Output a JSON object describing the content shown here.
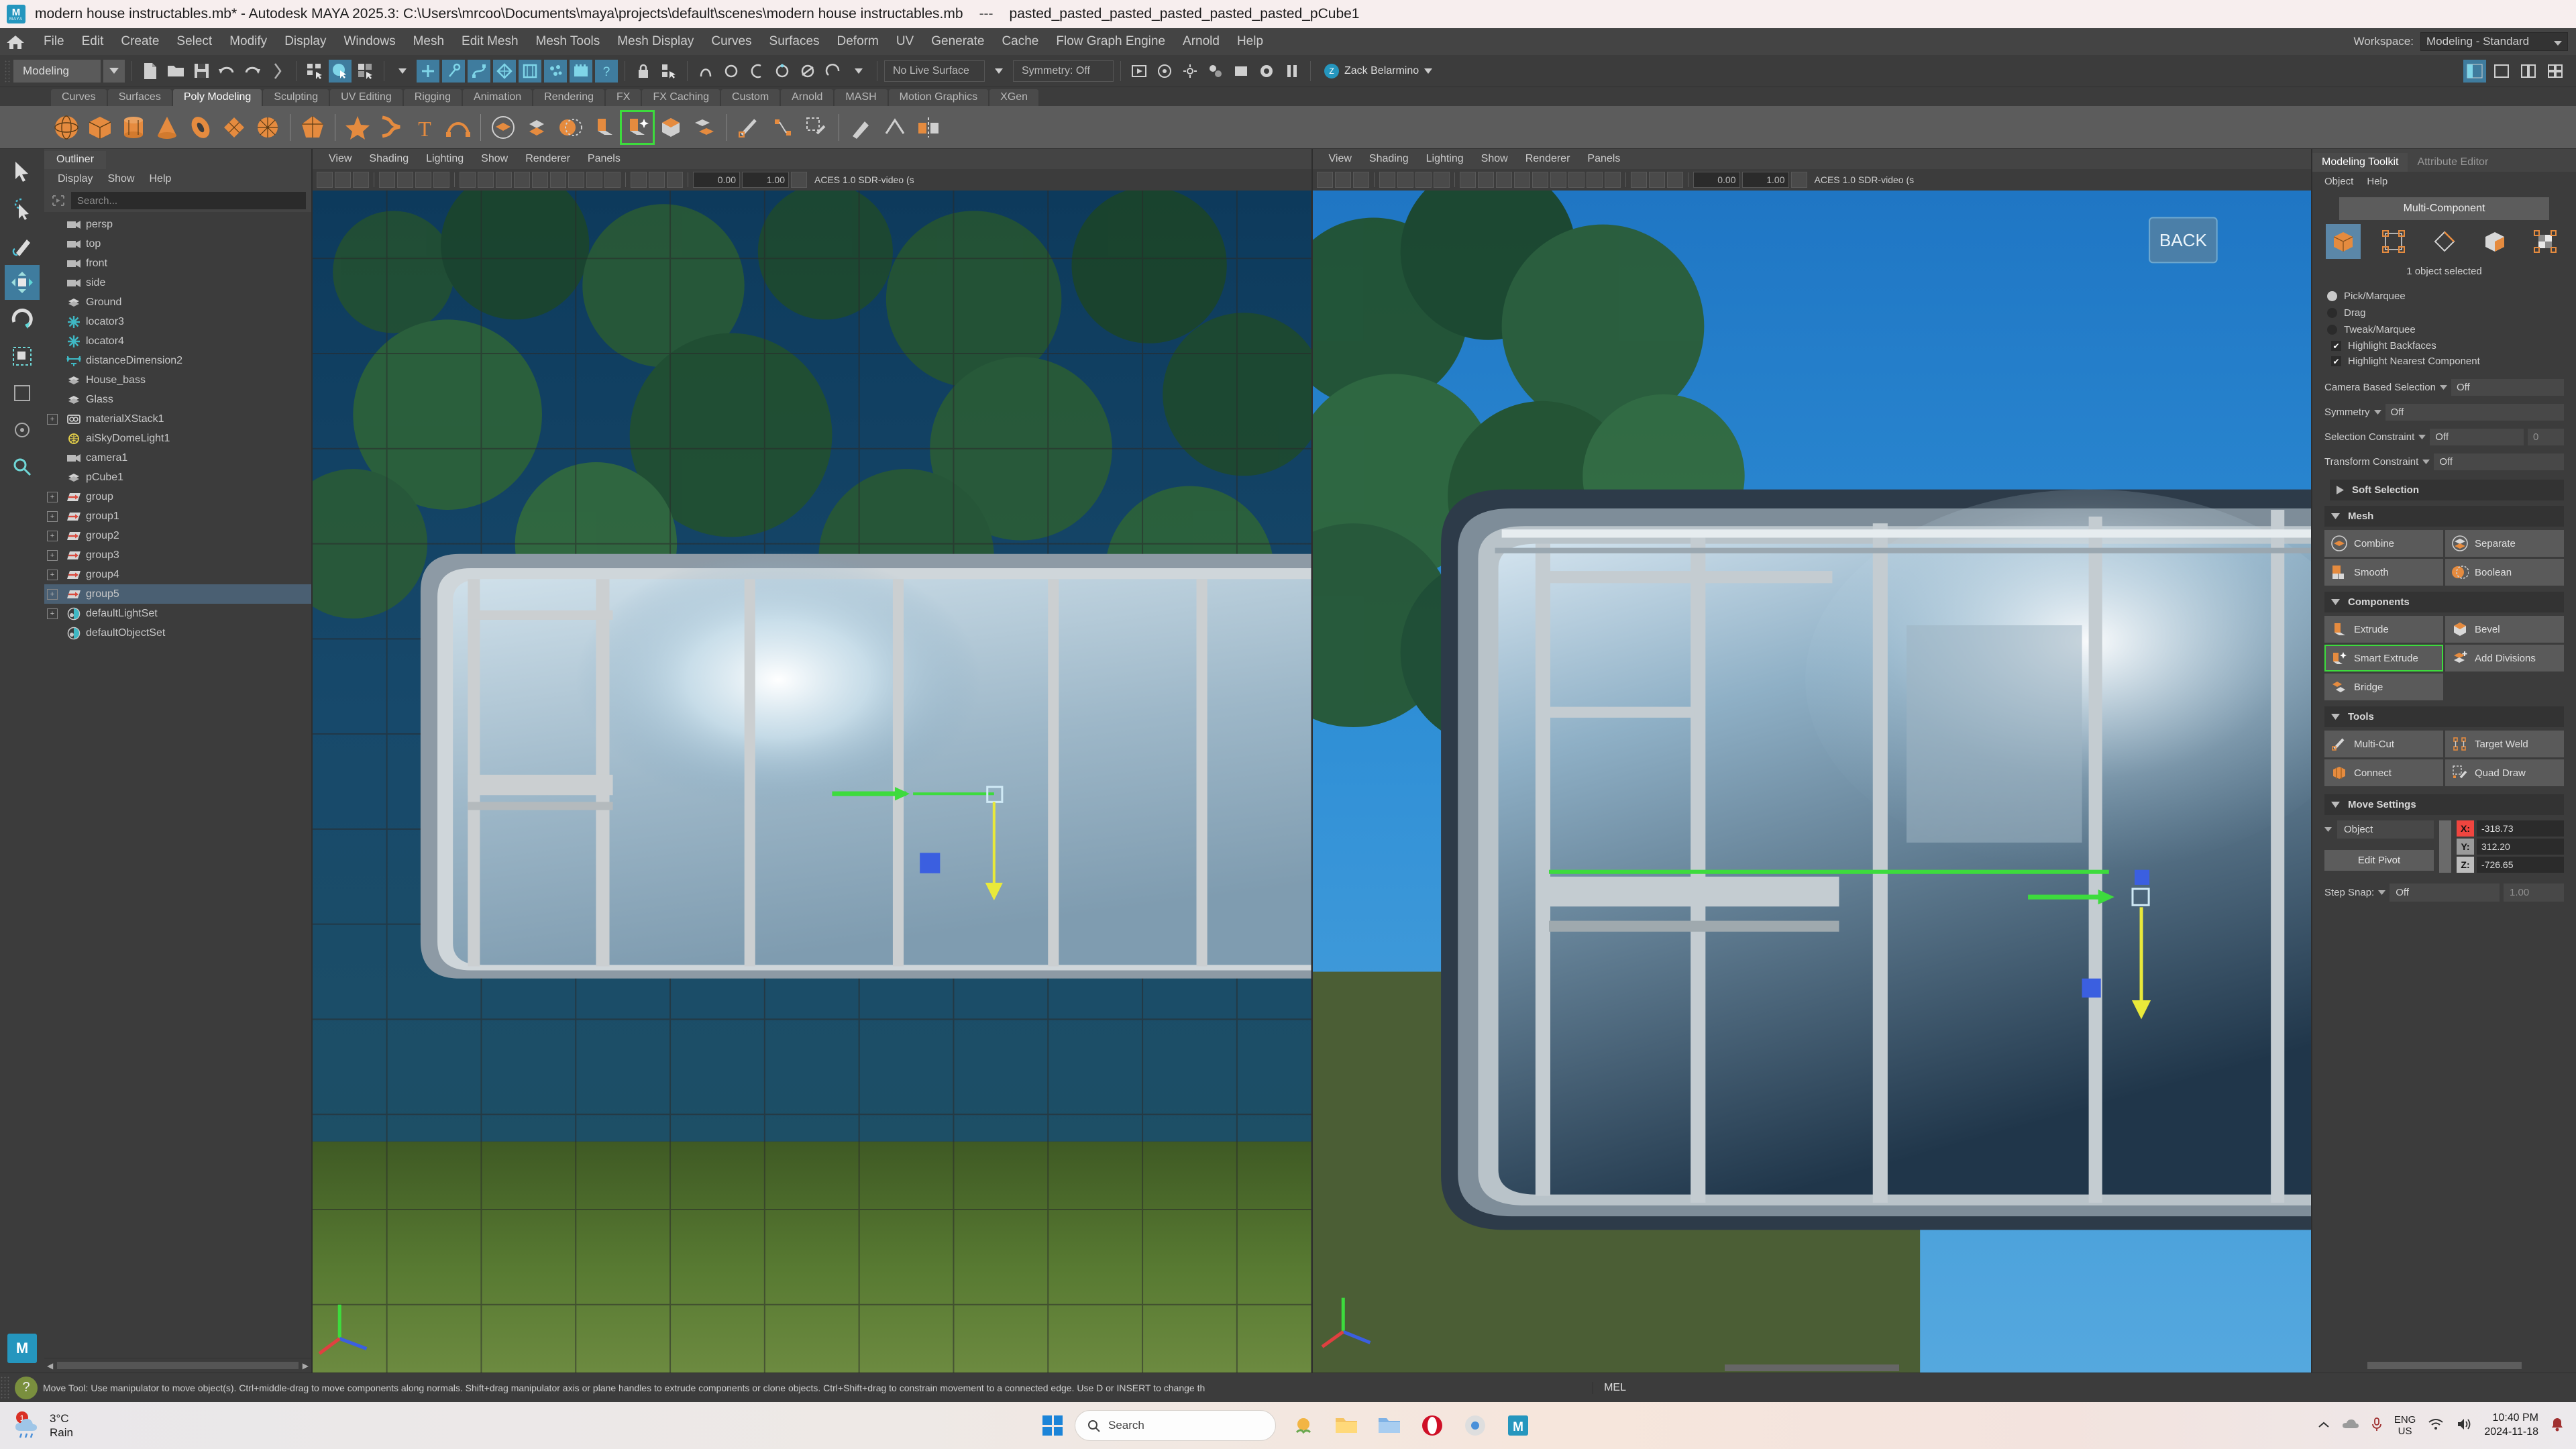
{
  "window": {
    "app_icon": "maya-logo",
    "title": "modern house instructables.mb* - Autodesk MAYA 2025.3: C:\\Users\\mrcoo\\Documents\\maya\\projects\\default\\scenes\\modern house instructables.mb",
    "separator": "---",
    "selected_object": "pasted_pasted_pasted_pasted_pasted_pasted_pCube1"
  },
  "menubar": {
    "home_icon": "home-icon",
    "items": [
      "File",
      "Edit",
      "Create",
      "Select",
      "Modify",
      "Display",
      "Windows",
      "Mesh",
      "Edit Mesh",
      "Mesh Tools",
      "Mesh Display",
      "Curves",
      "Surfaces",
      "Deform",
      "UV",
      "Generate",
      "Cache",
      "Flow Graph Engine",
      "Arnold",
      "Help"
    ],
    "workspace_label": "Workspace:",
    "workspace_value": "Modeling - Standard"
  },
  "statusline": {
    "menuset": "Modeling",
    "live_surface": "No Live Surface",
    "symmetry": "Symmetry: Off",
    "num_left": "0.00",
    "num_right": "1.00",
    "user_name": "Zack Belarmino"
  },
  "shelf": {
    "tabs": [
      "Curves",
      "Surfaces",
      "Poly Modeling",
      "Sculpting",
      "UV Editing",
      "Rigging",
      "Animation",
      "Rendering",
      "FX",
      "FX Caching",
      "Custom",
      "Arnold",
      "MASH",
      "Motion Graphics",
      "XGen"
    ],
    "active_tab": "Poly Modeling"
  },
  "toolbox": {
    "tools": [
      "select-tool",
      "lasso-select-tool",
      "paint-select-tool",
      "move-tool",
      "rotate-tool",
      "scale-tool",
      "last-tool",
      "show-manipulator-tool",
      "magnify-tool"
    ],
    "active": "move-tool",
    "badge": "M"
  },
  "outliner": {
    "tab": "Outliner",
    "menus": [
      "Display",
      "Show",
      "Help"
    ],
    "search_placeholder": "Search...",
    "items": [
      {
        "label": "persp",
        "icon": "camera-icon",
        "expandable": false,
        "selected": false
      },
      {
        "label": "top",
        "icon": "camera-icon",
        "expandable": false,
        "selected": false
      },
      {
        "label": "front",
        "icon": "camera-icon",
        "expandable": false,
        "selected": false
      },
      {
        "label": "side",
        "icon": "camera-icon",
        "expandable": false,
        "selected": false
      },
      {
        "label": "Ground",
        "icon": "mesh-icon",
        "expandable": false,
        "selected": false
      },
      {
        "label": "locator3",
        "icon": "locator-icon",
        "expandable": false,
        "selected": false
      },
      {
        "label": "locator4",
        "icon": "locator-icon",
        "expandable": false,
        "selected": false
      },
      {
        "label": "distanceDimension2",
        "icon": "distance-icon",
        "expandable": false,
        "selected": false
      },
      {
        "label": "House_bass",
        "icon": "mesh-icon",
        "expandable": false,
        "selected": false
      },
      {
        "label": "Glass",
        "icon": "mesh-icon",
        "expandable": false,
        "selected": false
      },
      {
        "label": "materialXStack1",
        "icon": "materialx-icon",
        "expandable": true,
        "selected": false
      },
      {
        "label": "aiSkyDomeLight1",
        "icon": "skydome-icon",
        "expandable": false,
        "selected": false
      },
      {
        "label": "camera1",
        "icon": "camera-icon",
        "expandable": false,
        "selected": false
      },
      {
        "label": "pCube1",
        "icon": "mesh-icon",
        "expandable": false,
        "selected": false
      },
      {
        "label": "group",
        "icon": "group-icon",
        "expandable": true,
        "selected": false
      },
      {
        "label": "group1",
        "icon": "group-icon",
        "expandable": true,
        "selected": false
      },
      {
        "label": "group2",
        "icon": "group-icon",
        "expandable": true,
        "selected": false
      },
      {
        "label": "group3",
        "icon": "group-icon",
        "expandable": true,
        "selected": false
      },
      {
        "label": "group4",
        "icon": "group-icon",
        "expandable": true,
        "selected": false
      },
      {
        "label": "group5",
        "icon": "group-icon",
        "expandable": true,
        "selected": true
      },
      {
        "label": "defaultLightSet",
        "icon": "set-icon",
        "expandable": true,
        "selected": false
      },
      {
        "label": "defaultObjectSet",
        "icon": "set-icon",
        "expandable": false,
        "selected": false
      }
    ]
  },
  "viewport_left": {
    "menus": [
      "View",
      "Shading",
      "Lighting",
      "Show",
      "Renderer",
      "Panels"
    ],
    "num_left": "0.00",
    "num_right": "1.00",
    "color_profile": "ACES 1.0 SDR-video (s"
  },
  "viewport_right": {
    "menus": [
      "View",
      "Shading",
      "Lighting",
      "Show",
      "Renderer",
      "Panels"
    ],
    "num_left": "0.00",
    "num_right": "1.00",
    "color_profile": "ACES 1.0 SDR-video (s",
    "view_cube_label": "BACK"
  },
  "right_panel": {
    "tabs": [
      "Modeling Toolkit",
      "Attribute Editor"
    ],
    "active_tab": "Modeling Toolkit",
    "menus": [
      "Object",
      "Help"
    ],
    "multi_component_button": "Multi-Component",
    "component_modes": [
      "object-mode-icon",
      "vertex-mode-icon",
      "edge-mode-icon",
      "face-mode-icon",
      "uv-mode-icon"
    ],
    "selection_status": "1 object selected",
    "radios": [
      {
        "label": "Pick/Marquee",
        "checked": true
      },
      {
        "label": "Drag",
        "checked": false
      },
      {
        "label": "Tweak/Marquee",
        "checked": false
      }
    ],
    "checkboxes": [
      {
        "label": "Highlight Backfaces",
        "checked": true
      },
      {
        "label": "Highlight Nearest Component",
        "checked": true
      }
    ],
    "dropdowns": [
      {
        "label": "Camera Based Selection",
        "value": "Off"
      },
      {
        "label": "Symmetry",
        "value": "Off"
      },
      {
        "label": "Selection Constraint",
        "value": "Off",
        "extra": "0"
      },
      {
        "label": "Transform Constraint",
        "value": "Off"
      }
    ],
    "sections": [
      {
        "title": "Soft Selection",
        "collapsed": true,
        "buttons": []
      },
      {
        "title": "Mesh",
        "collapsed": false,
        "buttons": [
          {
            "label": "Combine",
            "icon": "combine-icon",
            "highlight": false
          },
          {
            "label": "Separate",
            "icon": "separate-icon",
            "highlight": false
          },
          {
            "label": "Smooth",
            "icon": "smooth-icon",
            "highlight": false
          },
          {
            "label": "Boolean",
            "icon": "boolean-icon",
            "highlight": false
          }
        ]
      },
      {
        "title": "Components",
        "collapsed": false,
        "buttons": [
          {
            "label": "Extrude",
            "icon": "extrude-icon",
            "highlight": false
          },
          {
            "label": "Bevel",
            "icon": "bevel-icon",
            "highlight": false
          },
          {
            "label": "Smart Extrude",
            "icon": "smart-extrude-icon",
            "highlight": true
          },
          {
            "label": "Add Divisions",
            "icon": "add-divisions-icon",
            "highlight": false
          },
          {
            "label": "Bridge",
            "icon": "bridge-icon",
            "highlight": false
          }
        ]
      },
      {
        "title": "Tools",
        "collapsed": false,
        "buttons": [
          {
            "label": "Multi-Cut",
            "icon": "multi-cut-icon",
            "highlight": false
          },
          {
            "label": "Target Weld",
            "icon": "target-weld-icon",
            "highlight": false
          },
          {
            "label": "Connect",
            "icon": "connect-icon",
            "highlight": false
          },
          {
            "label": "Quad Draw",
            "icon": "quad-draw-icon",
            "highlight": false
          }
        ]
      }
    ],
    "move_settings": {
      "title": "Move Settings",
      "space_value": "Object",
      "edit_pivot": "Edit Pivot",
      "axis": [
        {
          "label": "X:",
          "value": "-318.73",
          "color": "#f0453f"
        },
        {
          "label": "Y:",
          "value": "312.20",
          "color": "#9a9a9a"
        },
        {
          "label": "Z:",
          "value": "-726.65",
          "color": "#bdbdbd"
        }
      ],
      "step_snap_label": "Step Snap:",
      "step_snap_value": "Off",
      "step_snap_amount": "1.00"
    }
  },
  "command_line": {
    "help_icon": "help-icon",
    "status_text": "Move Tool: Use manipulator to move object(s). Ctrl+middle-drag to move components along normals. Shift+drag manipulator axis or plane handles to extrude components or clone objects. Ctrl+Shift+drag to constrain movement to a connected edge. Use D or INSERT to change th",
    "mel_label": "MEL"
  },
  "taskbar": {
    "weather_temp": "3°C",
    "weather_desc": "Rain",
    "weather_badge": "1",
    "search_placeholder": "Search",
    "search_icon": "search-icon",
    "start_icon": "windows-start-icon",
    "apps": [
      "weather-widget",
      "file-explorer-icon",
      "folder-icon",
      "opera-icon",
      "chrome-icon",
      "maya-taskbar-icon"
    ],
    "tray": [
      "chevron-up-icon",
      "cloud-icon",
      "microphone-icon"
    ],
    "lang_line1": "ENG",
    "lang_line2": "US",
    "network_icon": "wifi-icon",
    "volume_icon": "speaker-icon",
    "time": "10:40 PM",
    "date": "2024-11-18",
    "notification_icon": "bell-icon"
  },
  "colors": {
    "maya_blue": "#2596be",
    "accent_orange": "#e58b3f",
    "highlight_green": "#3ddb3d",
    "selection_blue": "#4a5f72",
    "panel_bg": "#3c3c3c"
  }
}
